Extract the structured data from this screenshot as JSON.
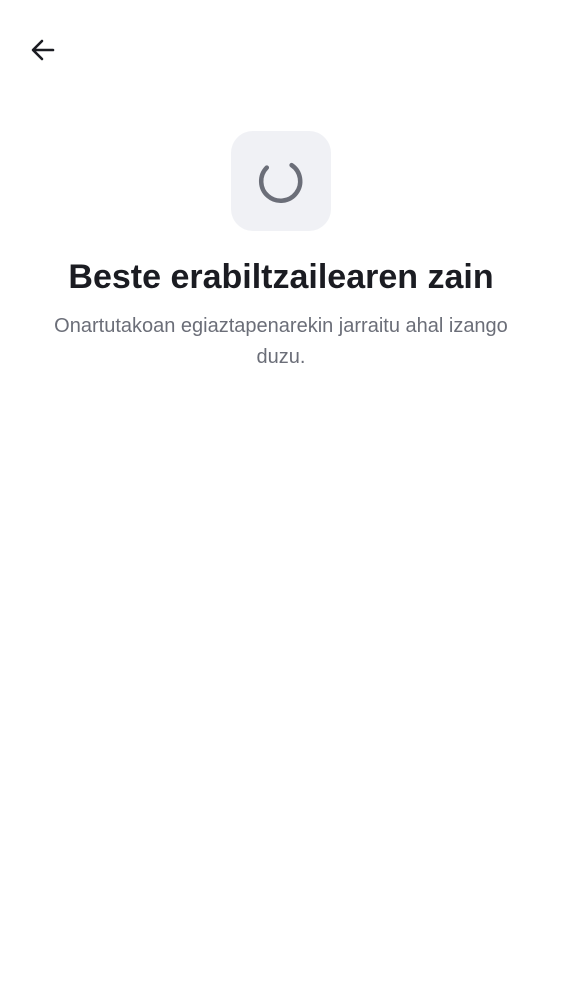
{
  "header": {
    "back_icon": "arrow-left-icon"
  },
  "status": {
    "icon": "loading-spinner-icon",
    "title": "Beste erabiltzailearen zain",
    "subtitle": "Onartutakoan egiaztapenarekin jarraitu ahal izango duzu."
  },
  "colors": {
    "background": "#ffffff",
    "tile_background": "#f0f1f5",
    "spinner": "#6b6e78",
    "title": "#1b1c22",
    "subtitle": "#6b6e78"
  }
}
